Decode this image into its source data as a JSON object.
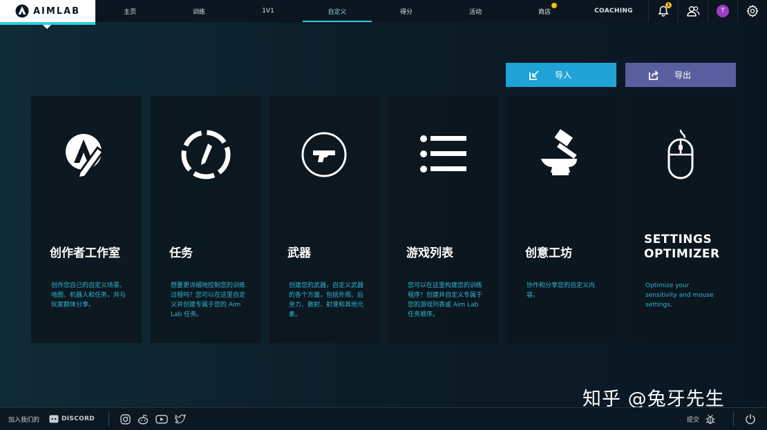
{
  "app": {
    "logo_text": "AIMLAB",
    "watermark": "知乎 @兔牙先生"
  },
  "nav": {
    "items": [
      {
        "label": "主页",
        "active": false
      },
      {
        "label": "训练",
        "active": false
      },
      {
        "label": "1V1",
        "active": false
      },
      {
        "label": "自定义",
        "active": true
      },
      {
        "label": "得分",
        "active": false
      },
      {
        "label": "活动",
        "active": false
      },
      {
        "label": "商店",
        "active": false,
        "dot": true
      },
      {
        "label": "COACHING",
        "active": false
      }
    ],
    "notification_count": "1",
    "avatar_initial": "T",
    "icons": [
      "bell-icon",
      "friends-icon",
      "avatar",
      "gear-icon"
    ]
  },
  "actions": {
    "import_label": "导入",
    "export_label": "导出"
  },
  "cards": [
    {
      "icon": "creator-studio-icon",
      "title": "创作者工作室",
      "desc": "创作您自己的自定义场景、地图、机器人和任务，并与玩家群体分享。"
    },
    {
      "icon": "task-icon",
      "title": "任务",
      "desc": "想要更详细地控制您的训练过程吗？您可以在这里自定义并创建专属于您的 Aim Lab 任务。"
    },
    {
      "icon": "weapon-icon",
      "title": "武器",
      "desc": "创建您的武器，自定义武器的各个方面，包括外观、后坐力、散射、射速和其他元素。"
    },
    {
      "icon": "playlist-icon",
      "title": "游戏列表",
      "desc": "您可以在这里构建您的训练程序！创建并自定义专属于您的游戏列表或 Aim Lab 任务顺序。"
    },
    {
      "icon": "workshop-icon",
      "title": "创意工坊",
      "desc": "协作和分享您的自定义内容。"
    },
    {
      "icon": "mouse-icon",
      "title": "SETTINGS OPTIMIZER",
      "desc": "Optimize your sensitivity and mouse settings."
    }
  ],
  "footer": {
    "join_label": "加入我们的",
    "discord_label": "DISCORD",
    "social_icons": [
      "instagram-icon",
      "reddit-icon",
      "youtube-icon",
      "twitter-icon"
    ],
    "submit_label": "提交"
  },
  "colors": {
    "accent": "#2fd0d8",
    "import_button": "#1fa3d6",
    "export_button": "#595f9e",
    "card_desc": "#2fb7d0",
    "badge": "#f4c20d",
    "avatar": "#9b3ec2"
  }
}
